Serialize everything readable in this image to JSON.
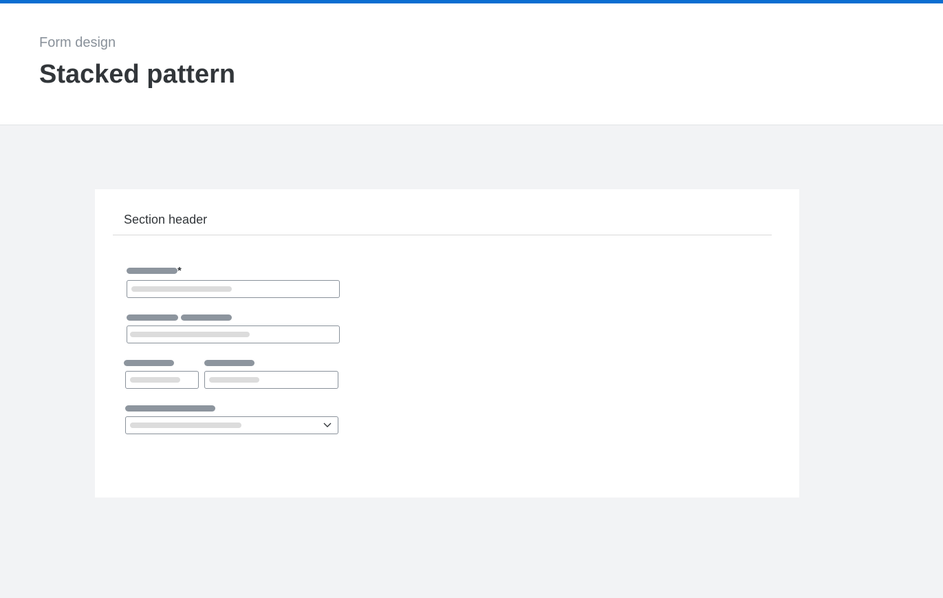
{
  "header": {
    "breadcrumb": "Form design",
    "title": "Stacked pattern"
  },
  "form": {
    "section_header": "Section header",
    "required_marker": "*",
    "dropdown_icon": "chevron-down-icon"
  },
  "colors": {
    "accent": "#0a6ed1",
    "page_background": "#f2f3f5",
    "label_placeholder": "#8d959e",
    "input_placeholder": "#dcdcdc"
  }
}
